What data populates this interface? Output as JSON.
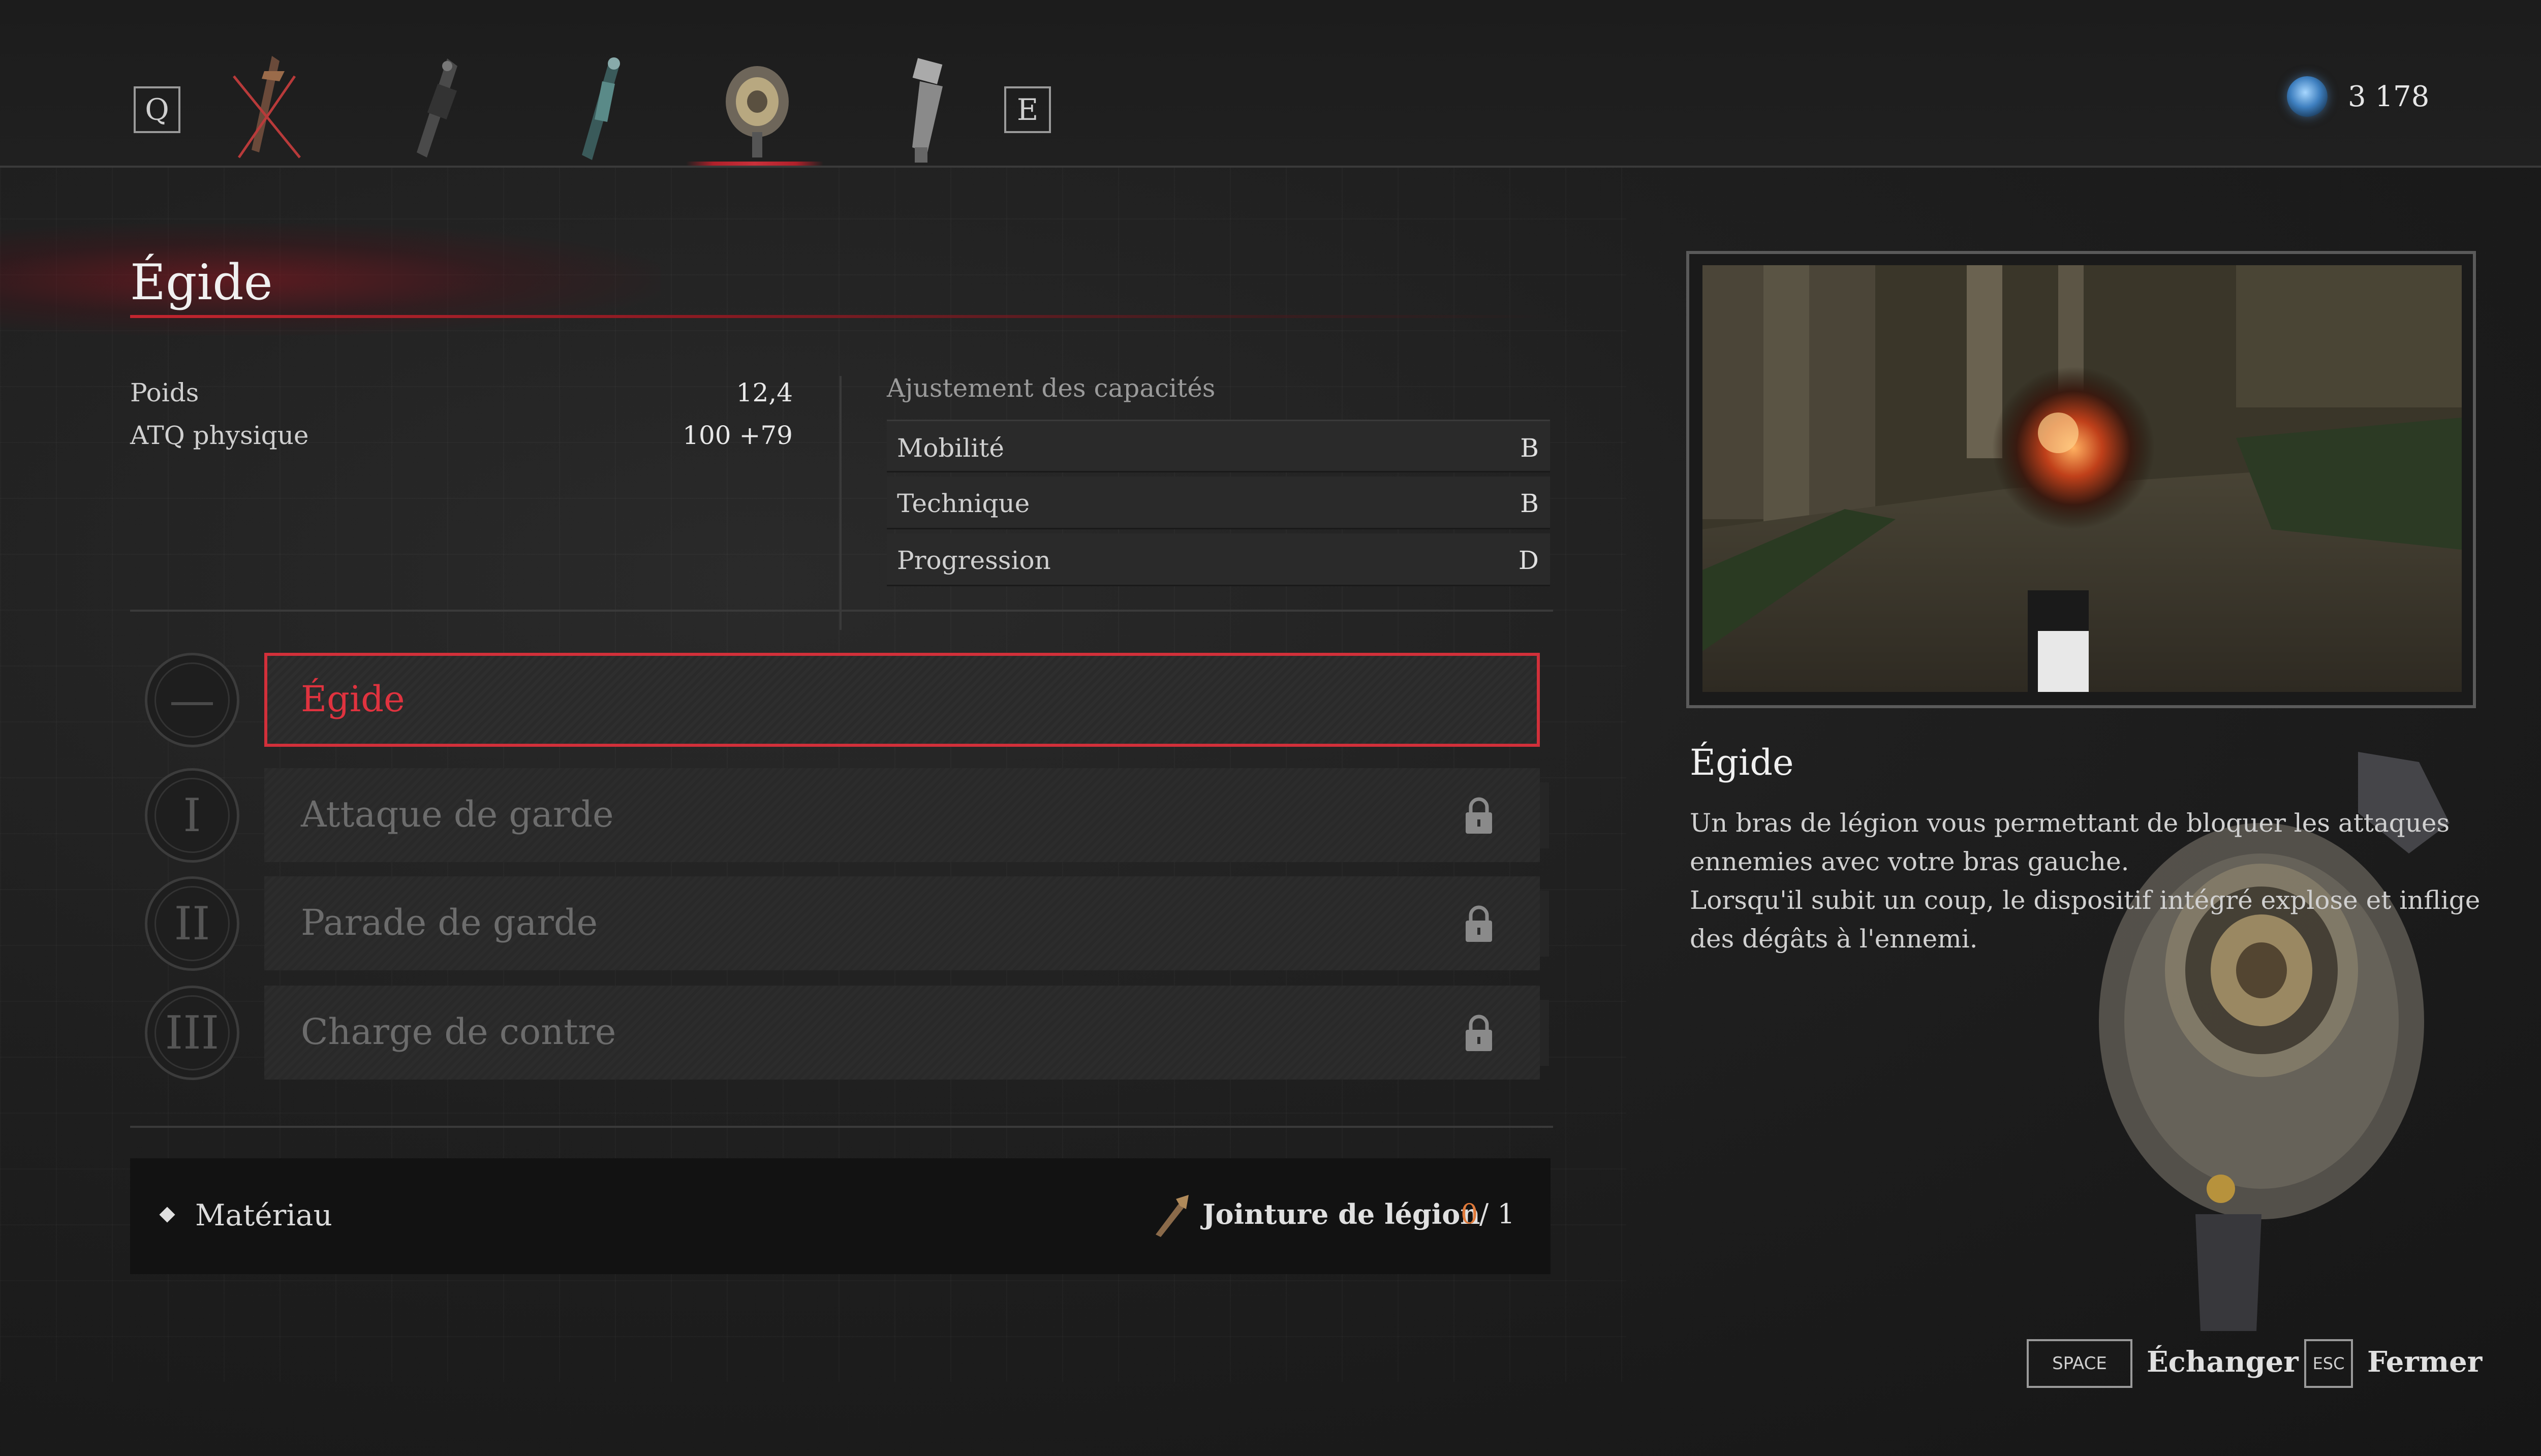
{
  "topbar": {
    "prev_key": "Q",
    "next_key": "E",
    "currency_value": "3 178",
    "currency_icon": "ergo-orb-icon",
    "arm_icons": [
      "arm-crossed-icon",
      "arm-slot-2-icon",
      "arm-slot-3-icon",
      "aegis-arm-icon",
      "arm-slot-5-icon"
    ]
  },
  "item": {
    "title": "Égide",
    "stats": [
      {
        "label": "Poids",
        "value": "12,4"
      },
      {
        "label": "ATQ physique",
        "value": "100 +79"
      }
    ],
    "adjustment_title": "Ajustement des capacités",
    "adjustments": [
      {
        "label": "Mobilité",
        "grade": "B"
      },
      {
        "label": "Technique",
        "grade": "B"
      },
      {
        "label": "Progression",
        "grade": "D"
      }
    ]
  },
  "skills": [
    {
      "numeral": "—",
      "name": "Égide",
      "locked": false,
      "selected": true
    },
    {
      "numeral": "I",
      "name": "Attaque de garde",
      "locked": true,
      "selected": false
    },
    {
      "numeral": "II",
      "name": "Parade de garde",
      "locked": true,
      "selected": false
    },
    {
      "numeral": "III",
      "name": "Charge de contre",
      "locked": true,
      "selected": false
    }
  ],
  "material": {
    "label": "Matériau",
    "required_name": "Jointure de légion",
    "have": "0",
    "total": "/ 1"
  },
  "description": {
    "title": "Égide",
    "lines": [
      "Un bras de légion vous permettant de bloquer les attaques",
      "ennemies avec votre bras gauche.",
      "Lorsqu'il subit un coup, le dispositif intégré explose et inflige",
      "des dégâts à l'ennemi."
    ]
  },
  "footer": {
    "swap_key": "SPACE",
    "swap_label": "Échanger",
    "close_key": "ESC",
    "close_label": "Fermer"
  },
  "colors": {
    "accent": "#d2303a",
    "material_have": "#e07a3a"
  }
}
